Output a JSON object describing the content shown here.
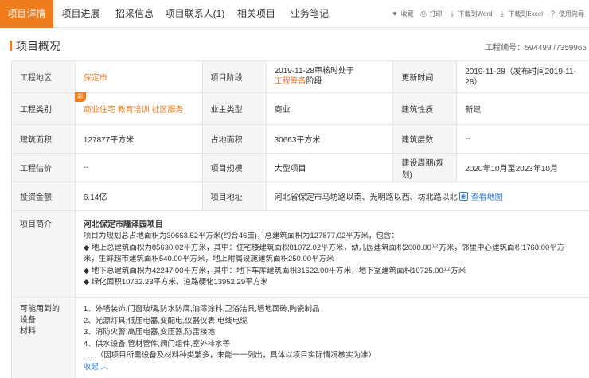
{
  "nav": {
    "tabs": [
      {
        "label": "项目详情"
      },
      {
        "label": "项目进展"
      },
      {
        "label": "招采信息"
      },
      {
        "label": "项目联系人(1)"
      },
      {
        "label": "相关项目"
      },
      {
        "label": "业务笔记"
      }
    ],
    "actions": [
      {
        "label": "收藏",
        "icon": "heart-icon"
      },
      {
        "label": "打印",
        "icon": "print-icon"
      },
      {
        "label": "下载到Word",
        "icon": "download-icon"
      },
      {
        "label": "下载到Excel",
        "icon": "download-icon"
      },
      {
        "label": "使用向导",
        "icon": "help-icon"
      }
    ]
  },
  "section": {
    "title": "项目概况",
    "project_no": "工程编号：594499 /7359965"
  },
  "table": {
    "r1": {
      "l1": "工程地区",
      "v1": "保定市",
      "l2": "项目阶段",
      "v2a": "2019-11-28审核时处于",
      "v2b": "工程筹备",
      "v2c": "阶段",
      "l3": "更新时间",
      "v3": "2019-11-28（发布时间2019-11-28）"
    },
    "r2": {
      "badge": "新",
      "l1": "工程类别",
      "v1": "商业住宅 教育培训 社区服务",
      "l2": "业主类型",
      "v2": "商业",
      "l3": "建筑性质",
      "v3": "新建"
    },
    "r3": {
      "l1": "建筑面积",
      "v1": "127877平方米",
      "l2": "占地面积",
      "v2": "30663平方米",
      "l3": "建筑层数",
      "v3": "--"
    },
    "r4": {
      "l1": "工程估价",
      "v1": "--",
      "l2": "项目规模",
      "v2": "大型项目",
      "l3": "建设周期(规划)",
      "v3": "2020年10月至2023年10月"
    },
    "r5": {
      "l1": "投资金额",
      "v1": "6.14亿",
      "l2": "项目地址",
      "v2": "河北省保定市马坊路以南、光明路以西、坊北路以北",
      "map_link": "查看地图"
    },
    "intro": {
      "label": "项目简介",
      "title": "河北保定市隆泽园项目",
      "lines": [
        "项目为规划总占地面积为30663.52平方米(约合46亩)，总建筑面积为127877.02平方米，包含：",
        "◆ 地上总建筑面积为85630.02平方米，其中：住宅楼建筑面积81072.02平方米，幼儿园建筑面积2000.00平方米，邻里中心建筑面积1768.00平方",
        "米，生鲜超市建筑面积540.00平方米，地上附属设施建筑面积250.00平方米",
        "◆ 地下总建筑面积为42247.00平方米，其中：地下车库建筑面积31522.00平方米，地下室建筑面积10725.00平方米",
        "◆ 绿化面积10732.23平方米，道路硬化13952.29平方米"
      ]
    },
    "materials": {
      "label_line1": "可能用到的设备",
      "label_line2": "材料",
      "lines": [
        "1、外墙装饰,门窗玻璃,防水防腐,油漆涂料,卫浴洁具,墙地面砖,陶瓷制品",
        "2、光源灯具,低压电器,变配电,仪器仪表,电线电缆",
        "3、消防火警,高压电器,变压器,防雷接地",
        "4、供水设备,管材管件,阀门组件,室外排水等",
        "......（因项目所需设备及材料种类繁多，未能一一列出，具体以项目实际情况核实为准）"
      ],
      "collapse": "收起 ︿"
    }
  }
}
